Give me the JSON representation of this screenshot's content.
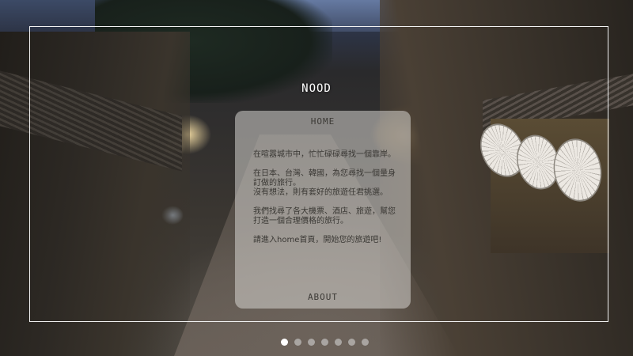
{
  "brand": {
    "label": "NOOD"
  },
  "card": {
    "title": "HOME",
    "paragraphs": [
      "在喧囂城市中，忙忙碌碌尋找一個靠岸。",
      "在日本、台灣、韓國，為您尋找一個量身訂做的旅行。\n沒有想法，則有套好的旅遊任君挑選。",
      "我們找尋了各大機票、酒店、旅遊，幫您打造一個合理價格的旅行。",
      "請進入home首頁，開始您的旅遊吧!"
    ],
    "link_label": "ABOUT"
  },
  "pagination": {
    "count": 7,
    "active_index": 0
  },
  "colors": {
    "frame": "#f2f2f2",
    "card_bg": "#dcdad6",
    "text": "#3a3834"
  },
  "icons": [
    "street-background-image"
  ]
}
